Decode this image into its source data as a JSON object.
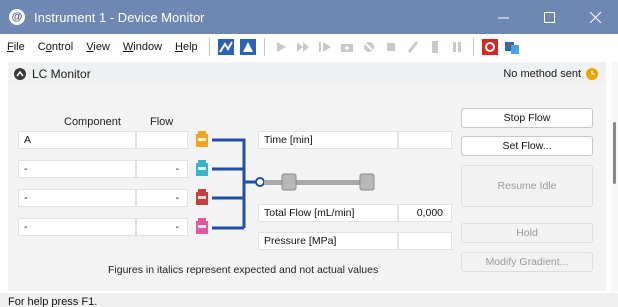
{
  "window": {
    "title": "Instrument 1 - Device Monitor",
    "controls": [
      "minimize",
      "maximize",
      "close"
    ]
  },
  "menu": [
    {
      "label": "File",
      "key": "F"
    },
    {
      "label": "Control",
      "key": "o"
    },
    {
      "label": "View",
      "key": "V"
    },
    {
      "label": "Window",
      "key": "W"
    },
    {
      "label": "Help",
      "key": "H"
    }
  ],
  "panel": {
    "title": "LC Monitor",
    "status": "No method sent"
  },
  "table": {
    "headers": {
      "component": "Component",
      "flow": "Flow"
    },
    "rows": [
      {
        "component": "A",
        "flow": ""
      },
      {
        "component": "-",
        "flow": "-"
      },
      {
        "component": "-",
        "flow": "-"
      },
      {
        "component": "-",
        "flow": "-"
      }
    ]
  },
  "readouts": {
    "time_label": "Time [min]",
    "time_value": "",
    "total_flow_label": "Total Flow [mL/min]",
    "total_flow_value": "0,000",
    "pressure_label": "Pressure [MPa]",
    "pressure_value": ""
  },
  "buttons": {
    "stop_flow": "Stop Flow",
    "set_flow": "Set Flow...",
    "resume_idle": "Resume Idle",
    "hold": "Hold",
    "modify_gradient": "Modify Gradient..."
  },
  "note": "Figures in italics represent expected and not actual values",
  "statusbar": "For help press F1.",
  "colors": {
    "titlebar": "#6e87b3",
    "pipe": "#1f4fa6",
    "bottle_a": "#f0a521",
    "bottle_b": "#3bb3c9",
    "bottle_c": "#c4423d",
    "bottle_d": "#e05a9d",
    "clock": "#e9a400"
  }
}
